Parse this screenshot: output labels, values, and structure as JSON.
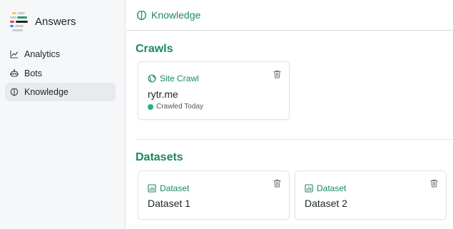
{
  "app": {
    "name": "Answers"
  },
  "sidebar": {
    "items": [
      {
        "label": "Analytics",
        "icon": "analytics-icon",
        "active": false
      },
      {
        "label": "Bots",
        "icon": "bot-icon",
        "active": false
      },
      {
        "label": "Knowledge",
        "icon": "brain-icon",
        "active": true
      }
    ]
  },
  "header": {
    "title": "Knowledge",
    "icon": "brain-icon"
  },
  "crawls": {
    "title": "Crawls",
    "cards": [
      {
        "type": "Site Crawl",
        "icon": "globe-icon",
        "name": "rytr.me",
        "status": "Crawled Today",
        "status_color": "#21b57a"
      }
    ]
  },
  "datasets": {
    "title": "Datasets",
    "cards": [
      {
        "type": "Dataset",
        "icon": "bar-chart-icon",
        "name": "Dataset 1"
      },
      {
        "type": "Dataset",
        "icon": "bar-chart-icon",
        "name": "Dataset 2"
      }
    ]
  },
  "colors": {
    "accent": "#1b8a5a",
    "status_green": "#21b57a",
    "sidebar_bg": "#f6f7f8",
    "active_bg": "#e8eaed"
  }
}
